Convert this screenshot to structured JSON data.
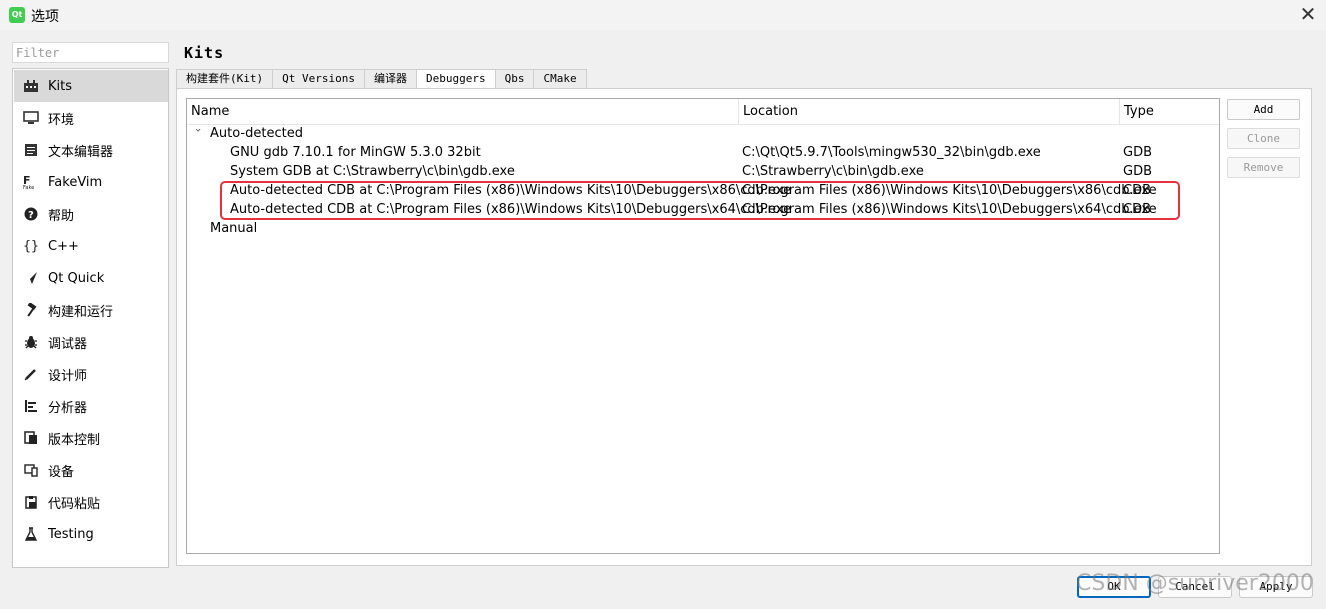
{
  "window": {
    "title": "选项",
    "icon_text": "Qt"
  },
  "filter": {
    "placeholder": "Filter"
  },
  "sidebar": {
    "items": [
      {
        "label": "Kits",
        "icon": "kits-icon"
      },
      {
        "label": "环境",
        "icon": "monitor-icon"
      },
      {
        "label": "文本编辑器",
        "icon": "text-editor-icon"
      },
      {
        "label": "FakeVim",
        "icon": "fakevim-icon"
      },
      {
        "label": "帮助",
        "icon": "help-icon"
      },
      {
        "label": "C++",
        "icon": "braces-icon"
      },
      {
        "label": "Qt Quick",
        "icon": "qtquick-icon"
      },
      {
        "label": "构建和运行",
        "icon": "hammer-icon"
      },
      {
        "label": "调试器",
        "icon": "bug-icon"
      },
      {
        "label": "设计师",
        "icon": "pen-icon"
      },
      {
        "label": "分析器",
        "icon": "analyzer-icon"
      },
      {
        "label": "版本控制",
        "icon": "version-control-icon"
      },
      {
        "label": "设备",
        "icon": "device-icon"
      },
      {
        "label": "代码粘贴",
        "icon": "clipboard-icon"
      },
      {
        "label": "Testing",
        "icon": "flask-icon"
      }
    ]
  },
  "page": {
    "title": "Kits"
  },
  "tabs": [
    {
      "label": "构建套件(Kit)"
    },
    {
      "label": "Qt Versions"
    },
    {
      "label": "编译器"
    },
    {
      "label": "Debuggers"
    },
    {
      "label": "Qbs"
    },
    {
      "label": "CMake"
    }
  ],
  "table": {
    "columns": [
      "Name",
      "Location",
      "Type"
    ],
    "groups": [
      {
        "label": "Auto-detected",
        "expander": "›",
        "rows": [
          {
            "name": "GNU gdb 7.10.1 for MinGW 5.3.0 32bit",
            "location": "C:\\Qt\\Qt5.9.7\\Tools\\mingw530_32\\bin\\gdb.exe",
            "type": "GDB"
          },
          {
            "name": "System GDB at C:\\Strawberry\\c\\bin\\gdb.exe",
            "location": "C:\\Strawberry\\c\\bin\\gdb.exe",
            "type": "GDB"
          },
          {
            "name": "Auto-detected CDB at C:\\Program Files (x86)\\Windows Kits\\10\\Debuggers\\x86\\cdb.exe",
            "location": "C:\\Program Files (x86)\\Windows Kits\\10\\Debuggers\\x86\\cdb.exe",
            "type": "CDB"
          },
          {
            "name": "Auto-detected CDB at C:\\Program Files (x86)\\Windows Kits\\10\\Debuggers\\x64\\cdb.exe",
            "location": "C:\\Program Files (x86)\\Windows Kits\\10\\Debuggers\\x64\\cdb.exe",
            "type": "CDB"
          }
        ]
      },
      {
        "label": "Manual",
        "rows": []
      }
    ]
  },
  "side_buttons": {
    "add": "Add",
    "clone": "Clone",
    "remove": "Remove"
  },
  "bottom_buttons": {
    "ok": "OK",
    "cancel": "Cancel",
    "apply": "Apply"
  },
  "watermark": "CSDN @sunriver2000",
  "colors": {
    "highlight_border": "#e8313f",
    "selected_item": "#d9d9d9",
    "default_button": "#0067c0"
  }
}
